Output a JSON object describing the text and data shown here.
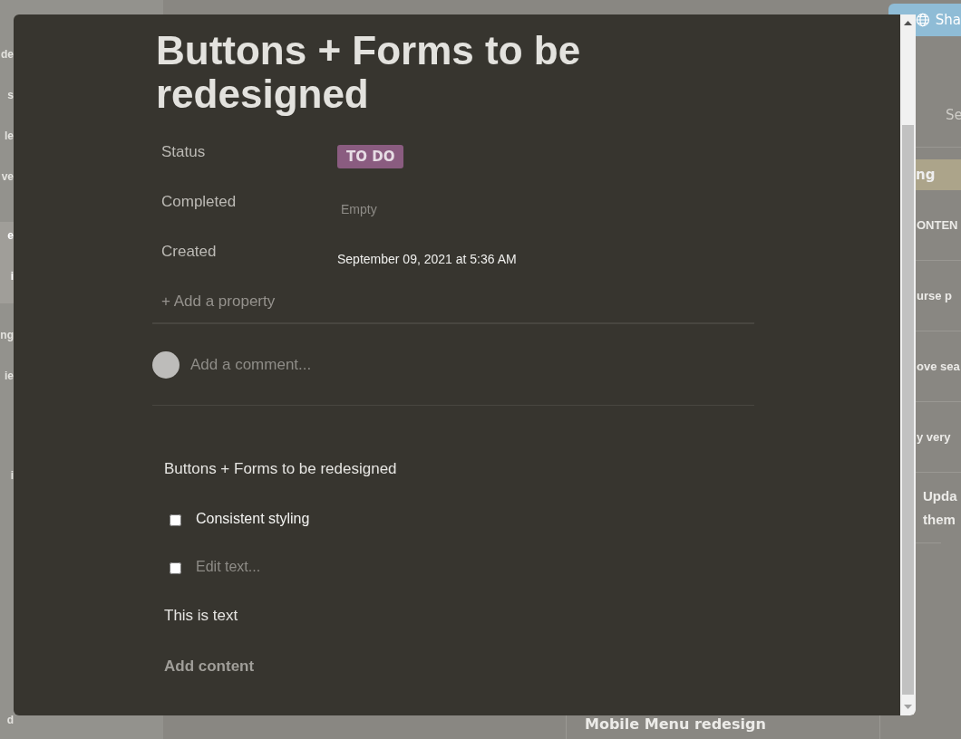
{
  "background": {
    "sidebar": [
      {
        "items": [
          {
            "label": "de",
            "selected": false
          },
          {
            "label": "s",
            "selected": false
          },
          {
            "label": "le",
            "selected": false
          },
          {
            "label": "ve",
            "selected": false
          }
        ]
      },
      {
        "items": [
          {
            "label": "e",
            "selected": true
          },
          {
            "label": "i",
            "selected": true
          }
        ]
      },
      {
        "items": [
          {
            "label": "ng",
            "selected": false
          },
          {
            "label": "ie",
            "selected": false
          }
        ]
      },
      {
        "items": [
          {
            "label": "i",
            "selected": false
          }
        ]
      },
      {
        "items": [
          {
            "label": "d",
            "selected": false
          }
        ]
      }
    ],
    "share_button": "Sha",
    "tab": "Se",
    "tag": "ng",
    "rows": [
      {
        "label": "ONTEN"
      },
      {
        "label": "urse p"
      },
      {
        "label": "ove sea"
      },
      {
        "label": "y very"
      },
      {
        "label": "Upda them"
      }
    ],
    "bottom_card": "Mobile Menu redesign"
  },
  "modal": {
    "title": "Buttons + Forms to be redesigned",
    "properties": [
      {
        "name": "Status",
        "kind": "tag",
        "value": "TO DO",
        "color": "#8a5c80"
      },
      {
        "name": "Completed",
        "kind": "empty",
        "value": "Empty"
      },
      {
        "name": "Created",
        "kind": "date",
        "value": "September 09, 2021 at 5:36 AM"
      }
    ],
    "add_property": "+ Add a property",
    "comment": {
      "placeholder": "Add a comment..."
    },
    "blocks": [
      {
        "kind": "text",
        "text": "Buttons + Forms to be redesigned"
      },
      {
        "kind": "todo",
        "text": "Consistent styling",
        "checked": false
      },
      {
        "kind": "todo",
        "placeholder": "Edit text...",
        "checked": false
      },
      {
        "kind": "text",
        "text": "This is text"
      }
    ],
    "add_content": "Add content"
  }
}
